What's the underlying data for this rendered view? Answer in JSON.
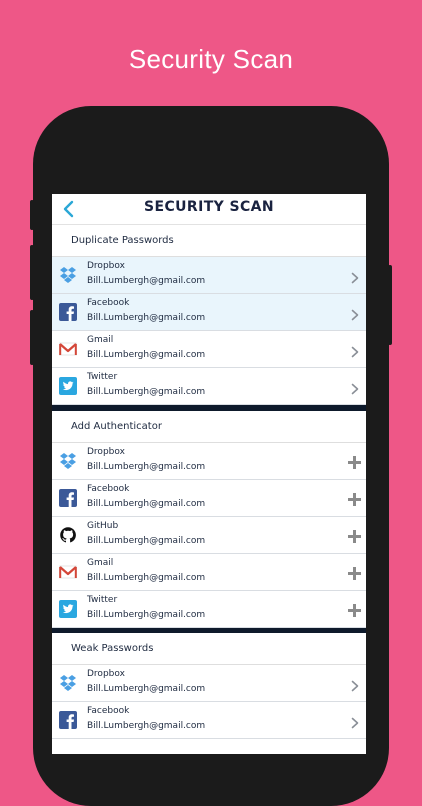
{
  "headline": "Security Scan",
  "nav": {
    "title": "SECURITY SCAN",
    "back_icon": "chevron-left-icon"
  },
  "colors": {
    "background": "#ee5787",
    "accent": "#2aa7d6",
    "divider": "#0e1a2b",
    "highlight": "#e9f5fc"
  },
  "sections": [
    {
      "title": "Duplicate Passwords",
      "action": "chevron",
      "items": [
        {
          "service": "Dropbox",
          "email": "Bill.Lumbergh@gmail.com",
          "icon": "dropbox-icon",
          "highlighted": true
        },
        {
          "service": "Facebook",
          "email": "Bill.Lumbergh@gmail.com",
          "icon": "facebook-icon",
          "highlighted": true
        },
        {
          "service": "Gmail",
          "email": "Bill.Lumbergh@gmail.com",
          "icon": "gmail-icon",
          "highlighted": false
        },
        {
          "service": "Twitter",
          "email": "Bill.Lumbergh@gmail.com",
          "icon": "twitter-icon",
          "highlighted": false
        }
      ]
    },
    {
      "title": "Add Authenticator",
      "action": "plus",
      "items": [
        {
          "service": "Dropbox",
          "email": "Bill.Lumbergh@gmail.com",
          "icon": "dropbox-icon"
        },
        {
          "service": "Facebook",
          "email": "Bill.Lumbergh@gmail.com",
          "icon": "facebook-icon"
        },
        {
          "service": "GitHub",
          "email": "Bill.Lumbergh@gmail.com",
          "icon": "github-icon"
        },
        {
          "service": "Gmail",
          "email": "Bill.Lumbergh@gmail.com",
          "icon": "gmail-icon"
        },
        {
          "service": "Twitter",
          "email": "Bill.Lumbergh@gmail.com",
          "icon": "twitter-icon"
        }
      ]
    },
    {
      "title": "Weak Passwords",
      "action": "chevron",
      "items": [
        {
          "service": "Dropbox",
          "email": "Bill.Lumbergh@gmail.com",
          "icon": "dropbox-icon"
        },
        {
          "service": "Facebook",
          "email": "Bill.Lumbergh@gmail.com",
          "icon": "facebook-icon"
        }
      ]
    }
  ]
}
